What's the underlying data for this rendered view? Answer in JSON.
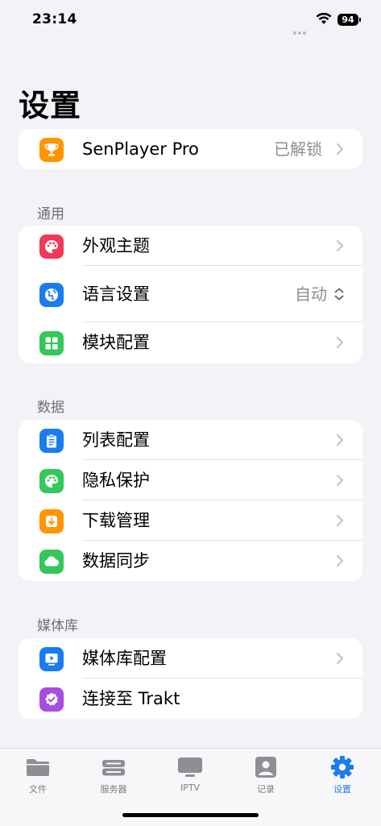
{
  "status": {
    "time": "23:14",
    "battery": "94"
  },
  "page_title": "设置",
  "pro": {
    "label": "SenPlayer Pro",
    "value": "已解锁"
  },
  "general": {
    "header": "通用",
    "items": [
      {
        "label": "外观主题",
        "icon": "palette-icon",
        "color": "#ee3a57"
      },
      {
        "label": "语言设置",
        "value": "自动",
        "icon": "globe-icon",
        "color": "#1b7cf0"
      },
      {
        "label": "模块配置",
        "icon": "grid-icon",
        "color": "#34c759"
      }
    ]
  },
  "data": {
    "header": "数据",
    "items": [
      {
        "label": "列表配置",
        "icon": "clipboard-icon",
        "color": "#1b7cf0"
      },
      {
        "label": "隐私保护",
        "icon": "palette-icon",
        "color": "#34c759"
      },
      {
        "label": "下载管理",
        "icon": "download-icon",
        "color": "#ff9500"
      },
      {
        "label": "数据同步",
        "icon": "cloud-icon",
        "color": "#34c759"
      }
    ]
  },
  "library": {
    "header": "媒体库",
    "items": [
      {
        "label": "媒体库配置",
        "icon": "play-tv-icon",
        "color": "#1b7cf0"
      },
      {
        "label": "连接至 Trakt",
        "icon": "check-badge-icon",
        "color": "#a54ee0"
      }
    ]
  },
  "tabs": [
    {
      "label": "文件",
      "icon": "folder-icon"
    },
    {
      "label": "服务器",
      "icon": "server-icon"
    },
    {
      "label": "IPTV",
      "icon": "tv-icon"
    },
    {
      "label": "记录",
      "icon": "contact-icon"
    },
    {
      "label": "设置",
      "icon": "gear-icon",
      "active": true
    }
  ],
  "colors": {
    "accent": "#1b7cf0",
    "trophy": "#ff9500",
    "background": "#f2f2f7"
  }
}
